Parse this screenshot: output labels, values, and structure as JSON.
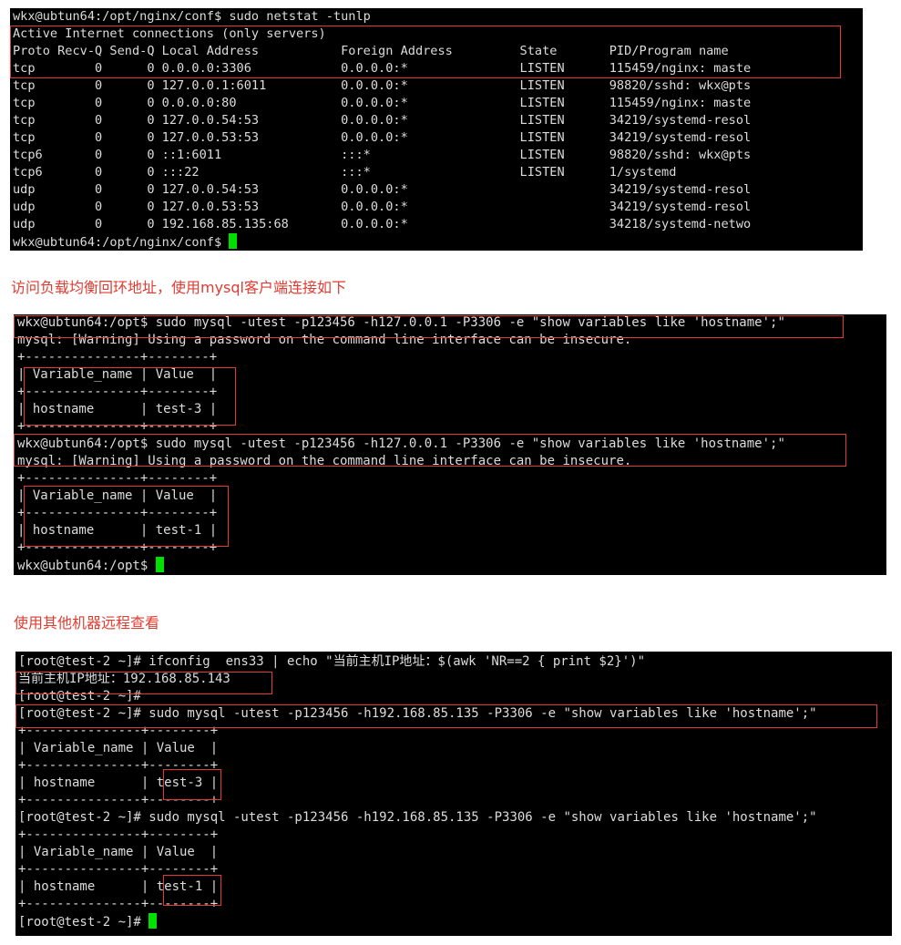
{
  "terminal1": {
    "lines": [
      "wkx@ubtun64:/opt/nginx/conf$ sudo netstat -tunlp",
      "Active Internet connections (only servers)",
      "Proto Recv-Q Send-Q Local Address           Foreign Address         State       PID/Program name",
      "tcp        0      0 0.0.0.0:3306            0.0.0.0:*               LISTEN      115459/nginx: maste",
      "tcp        0      0 127.0.0.1:6011          0.0.0.0:*               LISTEN      98820/sshd: wkx@pts",
      "tcp        0      0 0.0.0.0:80              0.0.0.0:*               LISTEN      115459/nginx: maste",
      "tcp        0      0 127.0.0.54:53           0.0.0.0:*               LISTEN      34219/systemd-resol",
      "tcp        0      0 127.0.0.53:53           0.0.0.0:*               LISTEN      34219/systemd-resol",
      "tcp6       0      0 ::1:6011                :::*                    LISTEN      98820/sshd: wkx@pts",
      "tcp6       0      0 :::22                   :::*                    LISTEN      1/systemd",
      "udp        0      0 127.0.0.54:53           0.0.0.0:*                           34219/systemd-resol",
      "udp        0      0 127.0.0.53:53           0.0.0.0:*                           34219/systemd-resol",
      "udp        0      0 192.168.85.135:68       0.0.0.0:*                           34218/systemd-netwo",
      "wkx@ubtun64:/opt/nginx/conf$ "
    ]
  },
  "caption1": "访问负载均衡回环地址，使用mysql客户端连接如下",
  "terminal2": {
    "lines": [
      "wkx@ubtun64:/opt$ sudo mysql -utest -p123456 -h127.0.0.1 -P3306 -e \"show variables like 'hostname';\"",
      "mysql: [Warning] Using a password on the command line interface can be insecure.",
      "+---------------+--------+",
      "| Variable_name | Value  |",
      "+---------------+--------+",
      "| hostname      | test-3 |",
      "+---------------+--------+",
      "wkx@ubtun64:/opt$ sudo mysql -utest -p123456 -h127.0.0.1 -P3306 -e \"show variables like 'hostname';\"",
      "mysql: [Warning] Using a password on the command line interface can be insecure.",
      "+---------------+--------+",
      "| Variable_name | Value  |",
      "+---------------+--------+",
      "| hostname      | test-1 |",
      "+---------------+--------+",
      "wkx@ubtun64:/opt$ "
    ]
  },
  "caption2": "使用其他机器远程查看",
  "terminal3": {
    "lines": [
      "[root@test-2 ~]# ifconfig  ens33 | echo \"当前主机IP地址：$(awk 'NR==2 { print $2}')\"",
      "当前主机IP地址：192.168.85.143",
      "[root@test-2 ~]#",
      "[root@test-2 ~]# sudo mysql -utest -p123456 -h192.168.85.135 -P3306 -e \"show variables like 'hostname';\"",
      "+---------------+--------+",
      "| Variable_name | Value  |",
      "+---------------+--------+",
      "| hostname      | test-3 |",
      "+---------------+--------+",
      "[root@test-2 ~]# sudo mysql -utest -p123456 -h192.168.85.135 -P3306 -e \"show variables like 'hostname';\"",
      "+---------------+--------+",
      "| Variable_name | Value  |",
      "+---------------+--------+",
      "| hostname      | test-1 |",
      "+---------------+--------+",
      "[root@test-2 ~]# "
    ]
  },
  "colors": {
    "terminal_bg": "#000000",
    "terminal_fg": "#dcdcdc",
    "caption": "#e03c31",
    "highlight_box": "#e53935",
    "cursor": "#00e000"
  }
}
